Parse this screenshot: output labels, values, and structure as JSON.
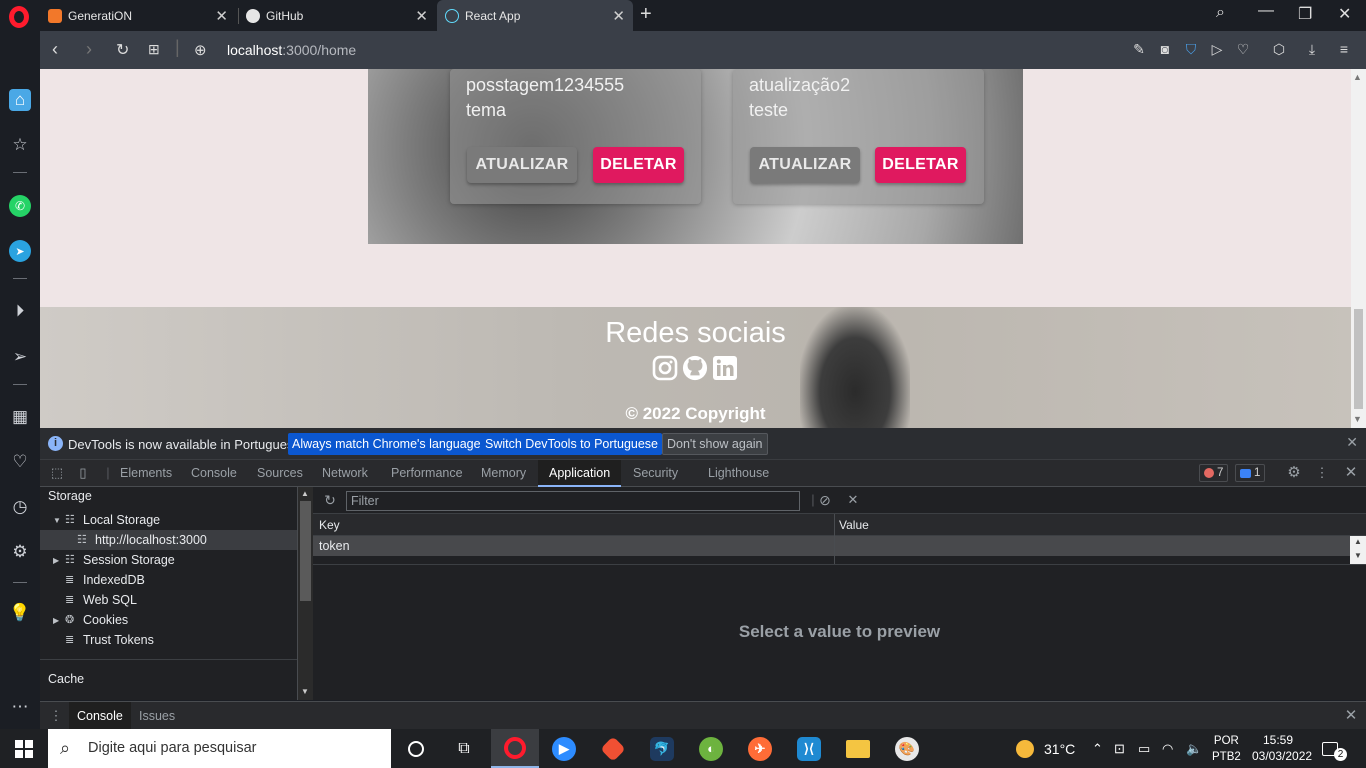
{
  "browser": {
    "tabs": [
      {
        "title": "GeneratiON",
        "favicon_color": "#f2782a"
      },
      {
        "title": "GitHub",
        "favicon_color": "#e6e6e6"
      },
      {
        "title": "React App",
        "favicon_color": "#61dafb"
      }
    ],
    "url_host": "localhost",
    "url_path": ":3000/home"
  },
  "page": {
    "cards": [
      {
        "line1": "posstagem1234555",
        "line2": "tema",
        "update_label": "ATUALIZAR",
        "delete_label": "DELETAR"
      },
      {
        "line1": "atualização2",
        "line2": "teste",
        "update_label": "ATUALIZAR",
        "delete_label": "DELETAR"
      }
    ],
    "footer": {
      "title": "Redes sociais",
      "copyright": "© 2022 Copyright",
      "social_icons": [
        "instagram-icon",
        "github-icon",
        "linkedin-icon"
      ]
    },
    "accent_color": "#e0195f"
  },
  "devtools": {
    "infobar": {
      "message": "DevTools is now available in Portuguese!",
      "btn_match": "Always match Chrome's language",
      "btn_switch": "Switch DevTools to Portuguese",
      "btn_dismiss": "Don't show again"
    },
    "tabs": [
      "Elements",
      "Console",
      "Sources",
      "Network",
      "Performance",
      "Memory",
      "Application",
      "Security",
      "Lighthouse"
    ],
    "active_tab": "Application",
    "error_count": "7",
    "message_count": "1",
    "storage": {
      "heading": "Storage",
      "local_storage": "Local Storage",
      "local_origin": "http://localhost:3000",
      "session_storage": "Session Storage",
      "indexeddb": "IndexedDB",
      "websql": "Web SQL",
      "cookies": "Cookies",
      "trust_tokens": "Trust Tokens",
      "cache_heading": "Cache"
    },
    "filter_placeholder": "Filter",
    "grid": {
      "key_header": "Key",
      "value_header": "Value",
      "rows": [
        {
          "key": "token",
          "value": ""
        }
      ]
    },
    "preview_text": "Select a value to preview",
    "drawer_tabs": [
      "Console",
      "Issues"
    ]
  },
  "taskbar": {
    "search_placeholder": "Digite aqui para pesquisar",
    "weather": "31°C",
    "lang1": "POR",
    "lang2": "PTB2",
    "time": "15:59",
    "date": "03/03/2022",
    "notifications": "2"
  }
}
